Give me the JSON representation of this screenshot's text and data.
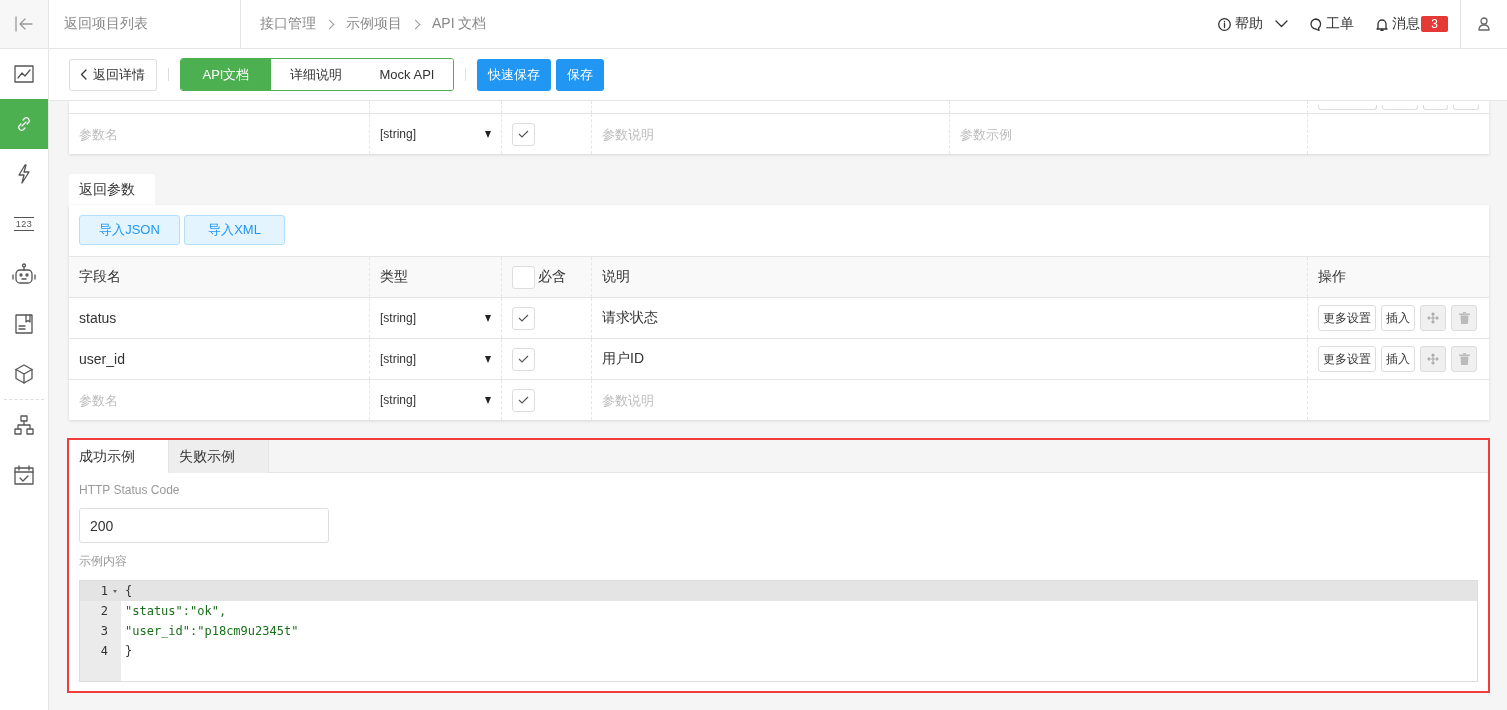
{
  "sidebar": {
    "collapse": {
      "kind": "collapse"
    },
    "items": [
      {
        "kind": "chart",
        "selected": false
      },
      {
        "kind": "link",
        "selected": true
      },
      {
        "kind": "lightning",
        "selected": false
      },
      {
        "kind": "number",
        "label": "123",
        "selected": false
      },
      {
        "kind": "robot",
        "selected": false
      },
      {
        "kind": "document",
        "selected": false
      },
      {
        "kind": "cube",
        "selected": false
      },
      {
        "kind": "separator"
      },
      {
        "kind": "hierarchy",
        "selected": false
      },
      {
        "kind": "calendar",
        "selected": false
      }
    ]
  },
  "header": {
    "back_link": "返回项目列表",
    "breadcrumb": [
      "接口管理",
      "示例项目",
      "API 文档"
    ],
    "help": "帮助",
    "ticket": "工单",
    "messages": {
      "label": "消息",
      "badge": "3"
    }
  },
  "toolbar": {
    "back_button": "返回详情",
    "tabs": [
      {
        "label": "API文档",
        "selected": true
      },
      {
        "label": "详细说明",
        "selected": false
      },
      {
        "label": "Mock API",
        "selected": false
      }
    ],
    "buttons": [
      "快速保存",
      "保存"
    ]
  },
  "request_params": {
    "new_row": {
      "name_placeholder": "参数名",
      "type": "[string]",
      "required": true,
      "description_placeholder": "参数说明",
      "example_placeholder": "参数示例"
    }
  },
  "response_params": {
    "tab": "返回参数",
    "import_buttons": [
      "导入JSON",
      "导入XML"
    ],
    "columns": {
      "name": "字段名",
      "type": "类型",
      "required": "必含",
      "description": "说明",
      "actions": "操作"
    },
    "header_checkbox_checked": false,
    "rows": [
      {
        "name": "status",
        "type": "[string]",
        "required": true,
        "description": "请求状态",
        "actions": [
          "更多设置",
          "插入"
        ]
      },
      {
        "name": "user_id",
        "type": "[string]",
        "required": true,
        "description": "用户ID",
        "actions": [
          "更多设置",
          "插入"
        ]
      }
    ],
    "new_row": {
      "name_placeholder": "参数名",
      "type": "[string]",
      "required": true,
      "description_placeholder": "参数说明"
    }
  },
  "examples": {
    "tabs": [
      {
        "label": "成功示例",
        "selected": true
      },
      {
        "label": "失败示例",
        "selected": false
      }
    ],
    "status_label": "HTTP Status Code",
    "status_code": "200",
    "content_label": "示例内容",
    "code_lines": [
      {
        "number": "1",
        "text": "{",
        "kind": "brace",
        "active": true,
        "foldable": true
      },
      {
        "number": "2",
        "text": "\"status\":\"ok\",",
        "kind": "pair",
        "active": false,
        "foldable": false
      },
      {
        "number": "3",
        "text": "\"user_id\":\"p18cm9u2345t\"",
        "kind": "pair",
        "active": false,
        "foldable": false
      },
      {
        "number": "4",
        "text": "}",
        "kind": "brace",
        "active": false,
        "foldable": false
      }
    ]
  }
}
